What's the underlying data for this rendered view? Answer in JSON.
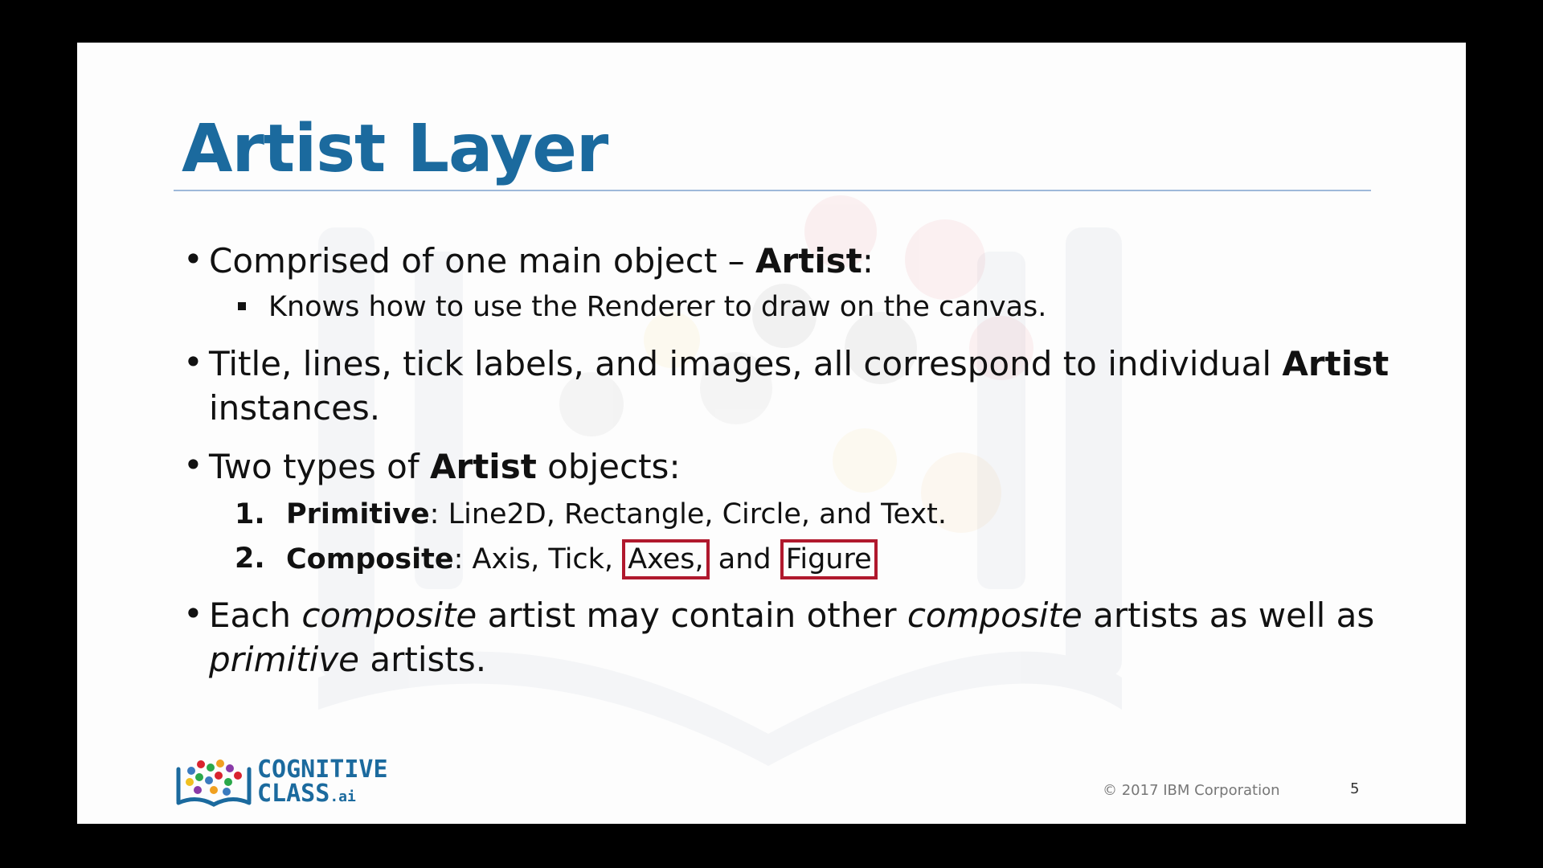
{
  "slide": {
    "title": "Artist Layer",
    "bullets": [
      {
        "parts": [
          {
            "text": "Comprised of one main object – ",
            "style": "normal"
          },
          {
            "text": "Artist",
            "style": "bold"
          },
          {
            "text": ":",
            "style": "normal"
          }
        ],
        "subs": [
          "Knows how to use the Renderer to draw on the canvas."
        ]
      },
      {
        "line1": [
          {
            "text": "Title, lines, tick labels, and images, all correspond to individual ",
            "style": "normal"
          },
          {
            "text": "Artist",
            "style": "bold"
          }
        ],
        "line2": "instances."
      },
      {
        "parts": [
          {
            "text": "Two types of ",
            "style": "normal"
          },
          {
            "text": "Artist",
            "style": "bold"
          },
          {
            "text": " objects:",
            "style": "normal"
          }
        ],
        "numbered": [
          {
            "num": "1.",
            "label": "Primitive",
            "rest": ": Line2D, Rectangle, Circle, and Text."
          },
          {
            "num": "2.",
            "label": "Composite",
            "rest_a": ": Axis, Tick, ",
            "boxed_a": "Axes,",
            "rest_b": " and ",
            "boxed_b": "Figure"
          }
        ]
      },
      {
        "line1": [
          {
            "text": "Each ",
            "style": "normal"
          },
          {
            "text": "composite",
            "style": "italic"
          },
          {
            "text": " artist may contain other ",
            "style": "normal"
          },
          {
            "text": "composite",
            "style": "italic"
          },
          {
            "text": " artists as well as",
            "style": "normal"
          }
        ],
        "line2": [
          {
            "text": "primitive",
            "style": "italic"
          },
          {
            "text": " artists.",
            "style": "normal"
          }
        ]
      }
    ]
  },
  "footer": {
    "logo_line1": "COGNITIVE",
    "logo_line2": "CLASS",
    "logo_suffix": ".ai",
    "copyright": "© 2017 IBM Corporation",
    "page_number": "5"
  },
  "colors": {
    "title": "#1b6a9e",
    "highlight_box": "#b0182d",
    "background": "#000000",
    "slide": "#fdfdfd"
  },
  "icons": [
    "square-bullet-icon",
    "cognitive-class-logo"
  ]
}
